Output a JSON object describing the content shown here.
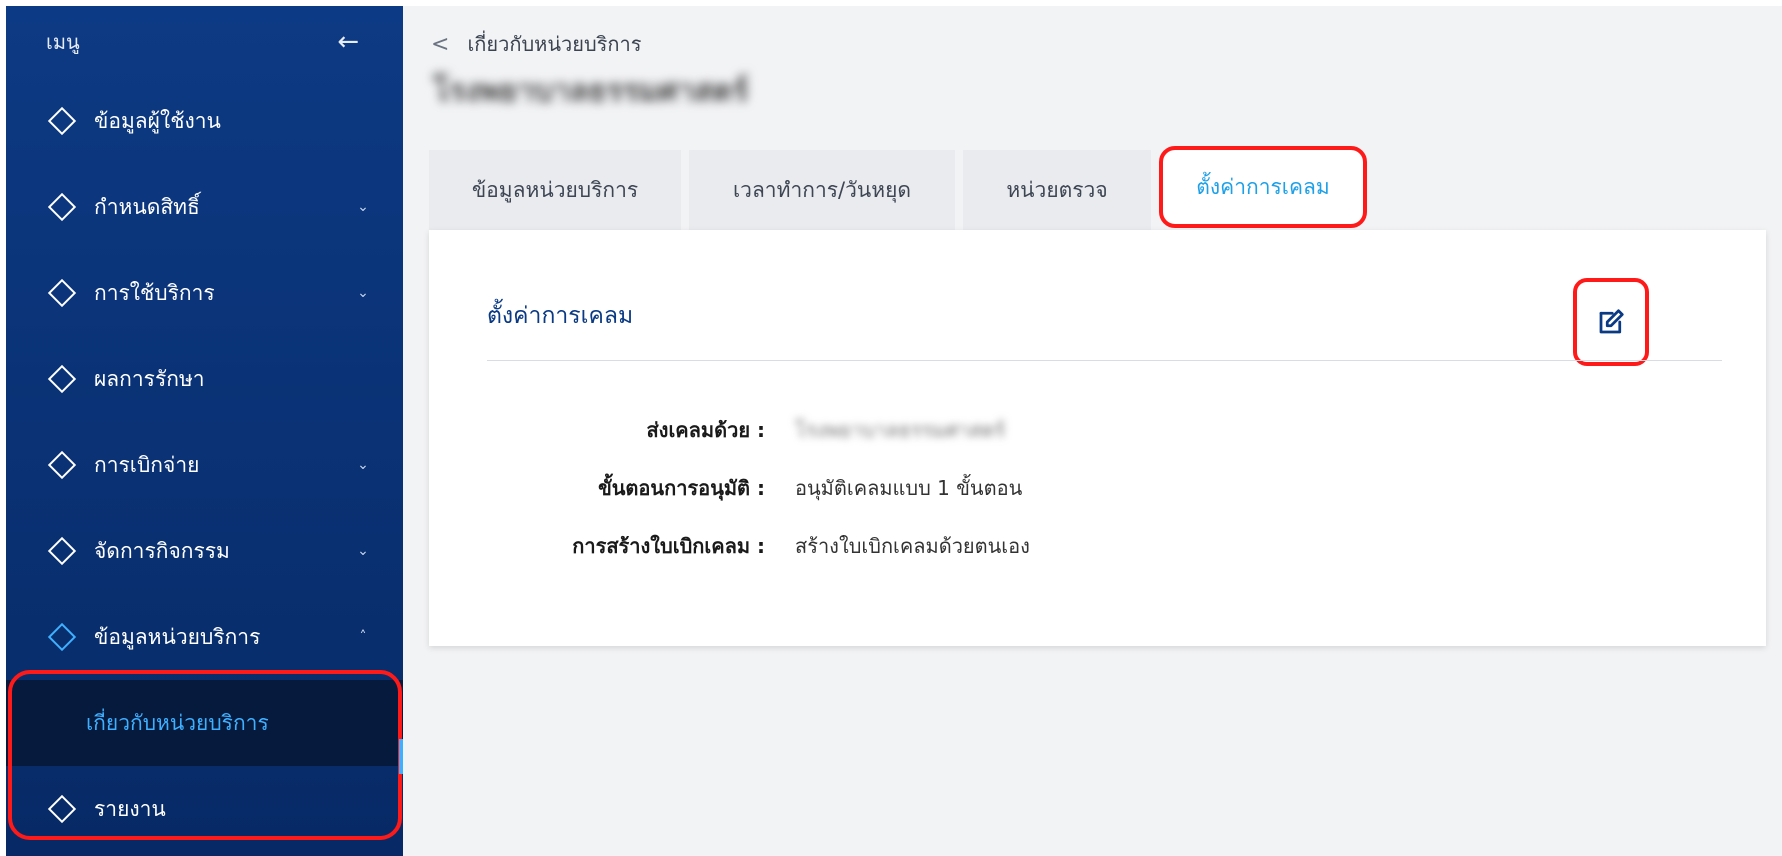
{
  "sidebar": {
    "title": "เมนู",
    "items": [
      {
        "label": "ข้อมูลผู้ใช้งาน",
        "chevron": ""
      },
      {
        "label": "กำหนดสิทธิ์",
        "chevron": "⌄"
      },
      {
        "label": "การใช้บริการ",
        "chevron": "⌄"
      },
      {
        "label": "ผลการรักษา",
        "chevron": ""
      },
      {
        "label": "การเบิกจ่าย",
        "chevron": "⌄"
      },
      {
        "label": "จัดการกิจกรรม",
        "chevron": "⌄"
      },
      {
        "label": "ข้อมูลหน่วยบริการ",
        "chevron": "˄"
      },
      {
        "label": "รายงาน",
        "chevron": ""
      }
    ],
    "sub_item": "เกี่ยวกับหน่วยบริการ"
  },
  "breadcrumb": {
    "label": "เกี่ยวกับหน่วยบริการ"
  },
  "page_title": "โรงพยาบาลธรรมศาสตร์",
  "tabs": [
    "ข้อมูลหน่วยบริการ",
    "เวลาทำการ/วันหยุด",
    "หน่วยตรวจ",
    "ตั้งค่าการเคลม"
  ],
  "card": {
    "title": "ตั้งค่าการเคลม",
    "rows": [
      {
        "key": "ส่งเคลมด้วย :",
        "value": "โรงพยาบาลธรรมศาสตร์"
      },
      {
        "key": "ขั้นตอนการอนุมัติ :",
        "value": "อนุมัติเคลมแบบ 1 ขั้นตอน"
      },
      {
        "key": "การสร้างใบเบิกเคลม :",
        "value": "สร้างใบเบิกเคลมด้วยตนเอง"
      }
    ]
  },
  "colors": {
    "accent": "#1ea0e8",
    "sidebar": "#0d3a84",
    "highlight": "#ff1a1a"
  }
}
